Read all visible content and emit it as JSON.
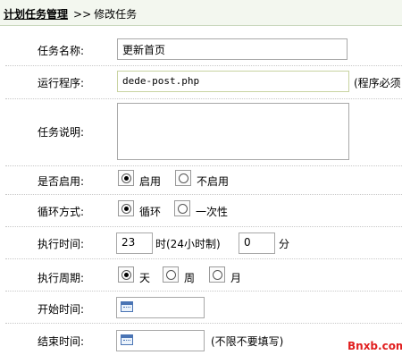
{
  "breadcrumb": {
    "parent": "计划任务管理",
    "separator": ">>",
    "current": "修改任务"
  },
  "form": {
    "task_name": {
      "label": "任务名称:",
      "value": "更新首页"
    },
    "program": {
      "label": "运行程序:",
      "value": "dede-post.php",
      "note": "(程序必须"
    },
    "description": {
      "label": "任务说明:",
      "value": ""
    },
    "enabled": {
      "label": "是否启用:",
      "options": [
        "启用",
        "不启用"
      ],
      "selected": "启用"
    },
    "cycle": {
      "label": "循环方式:",
      "options": [
        "循环",
        "一次性"
      ],
      "selected": "循环"
    },
    "exec_time": {
      "label": "执行时间:",
      "hour": "23",
      "hour_unit": "时(24小时制)",
      "minute": "0",
      "minute_unit": "分"
    },
    "period": {
      "label": "执行周期:",
      "options": [
        "天",
        "周",
        "月"
      ],
      "selected": "天"
    },
    "start_time": {
      "label": "开始时间:",
      "value": ""
    },
    "end_time": {
      "label": "结束时间:",
      "value": "",
      "hint": "(不限不要填写)"
    }
  },
  "watermark": "Bnxb.com",
  "icons": {
    "calendar": "calendar-icon"
  }
}
